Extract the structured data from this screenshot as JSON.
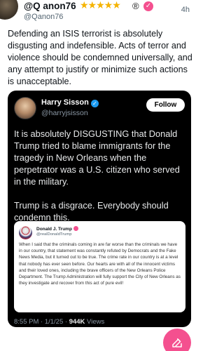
{
  "post": {
    "author_name": "@Q anon76",
    "stars": "★★★★★",
    "registered_mark": "®",
    "handle": "@Qanon76",
    "time": "4h",
    "text": "Defending an ISIS terrorist is absolutely disgusting and indefensible. Acts of terror and violence should be condemned universally, and any attempt to justify or minimize such actions is unacceptable."
  },
  "quoted": {
    "name": "Harry Sisson",
    "handle": "@harryjsisson",
    "follow_label": "Follow",
    "paragraph_1": "It is absolutely DISGUSTING that Donald Trump tried to blame immigrants for the tragedy in New Orleans when the perpetrator was a U.S. citizen who served in the military.",
    "paragraph_2": "Trump is a disgrace. Everybody should condemn this.",
    "timestamp": "8:55 PM · 1/1/25 · ",
    "views": "944K",
    "views_label": "Views"
  },
  "nested": {
    "name": "Donald J. Trump",
    "handle": "@realDonaldTrump",
    "text": "When I said that the criminals coming in are far worse than the criminals we have in our country, that statement was constantly refuted by Democrats and the Fake News Media, but it turned out to be true. The crime rate in our country is at a level that nobody has ever seen before. Our hearts are with all of the innocent victims and their loved ones, including the brave officers of the New Orleans Police Department. The Trump Administration will fully support the City of New Orleans as they investigate and recover from this act of pure evil!"
  },
  "colors": {
    "accent_pink": "#f4508f",
    "verified_blue": "#1d9bf0",
    "star_gold": "#f5b301"
  }
}
